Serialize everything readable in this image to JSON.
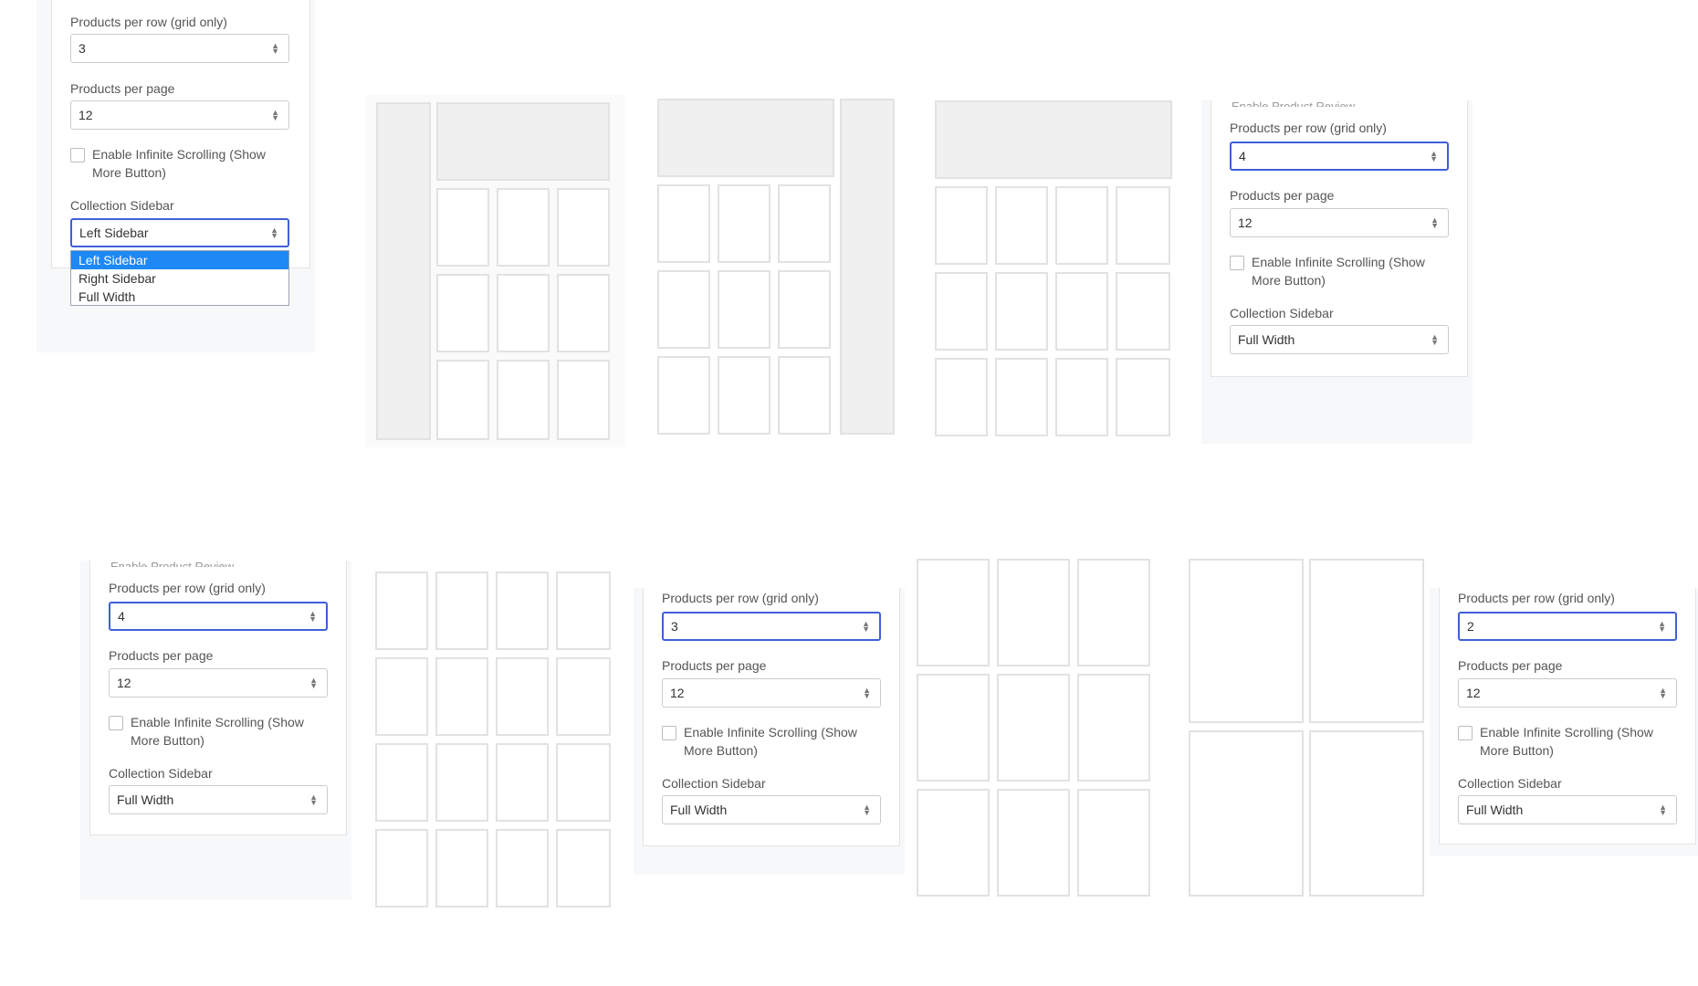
{
  "panels": [
    {
      "products_per_row": {
        "label": "Products per row (grid only)",
        "value": "3"
      },
      "products_per_page": {
        "label": "Products per page",
        "value": "12"
      },
      "infinite": {
        "label_line1": "Enable Infinite Scrolling (Show",
        "label_line2": "More Button)"
      },
      "sidebar": {
        "label": "Collection Sidebar",
        "value": "Left Sidebar"
      },
      "dropdown_options": [
        "Left Sidebar",
        "Right Sidebar",
        "Full Width"
      ]
    },
    {
      "cut_text": "Enable Product Review",
      "products_per_row": {
        "label": "Products per row (grid only)",
        "value": "4"
      },
      "products_per_page": {
        "label": "Products per page",
        "value": "12"
      },
      "infinite": {
        "label_line1": "Enable Infinite Scrolling (Show",
        "label_line2": "More Button)"
      },
      "sidebar": {
        "label": "Collection Sidebar",
        "value": "Full Width"
      }
    },
    {
      "cut_text": "Enable Product Review",
      "products_per_row": {
        "label": "Products per row (grid only)",
        "value": "4"
      },
      "products_per_page": {
        "label": "Products per page",
        "value": "12"
      },
      "infinite": {
        "label_line1": "Enable Infinite Scrolling (Show",
        "label_line2": "More Button)"
      },
      "sidebar": {
        "label": "Collection Sidebar",
        "value": "Full Width"
      }
    },
    {
      "products_per_row": {
        "label": "Products per row (grid only)",
        "value": "3"
      },
      "products_per_page": {
        "label": "Products per page",
        "value": "12"
      },
      "infinite": {
        "label_line1": "Enable Infinite Scrolling (Show",
        "label_line2": "More Button)"
      },
      "sidebar": {
        "label": "Collection Sidebar",
        "value": "Full Width"
      }
    },
    {
      "products_per_row": {
        "label": "Products per row (grid only)",
        "value": "2"
      },
      "products_per_page": {
        "label": "Products per page",
        "value": "12"
      },
      "infinite": {
        "label_line1": "Enable Infinite Scrolling (Show",
        "label_line2": "More Button)"
      },
      "sidebar": {
        "label": "Collection Sidebar",
        "value": "Full Width"
      }
    }
  ],
  "layouts": [
    {
      "name": "left-sidebar-3-col"
    },
    {
      "name": "right-sidebar-3-col"
    },
    {
      "name": "full-width-4-col"
    },
    {
      "name": "full-width-4-col-grid"
    },
    {
      "name": "full-width-3-col-grid"
    },
    {
      "name": "full-width-2-col-grid"
    }
  ],
  "colors": {
    "focus_border": "#3f5fd8",
    "selected_option": "#1e88f5",
    "placeholder_gray": "#f0f0f0"
  }
}
